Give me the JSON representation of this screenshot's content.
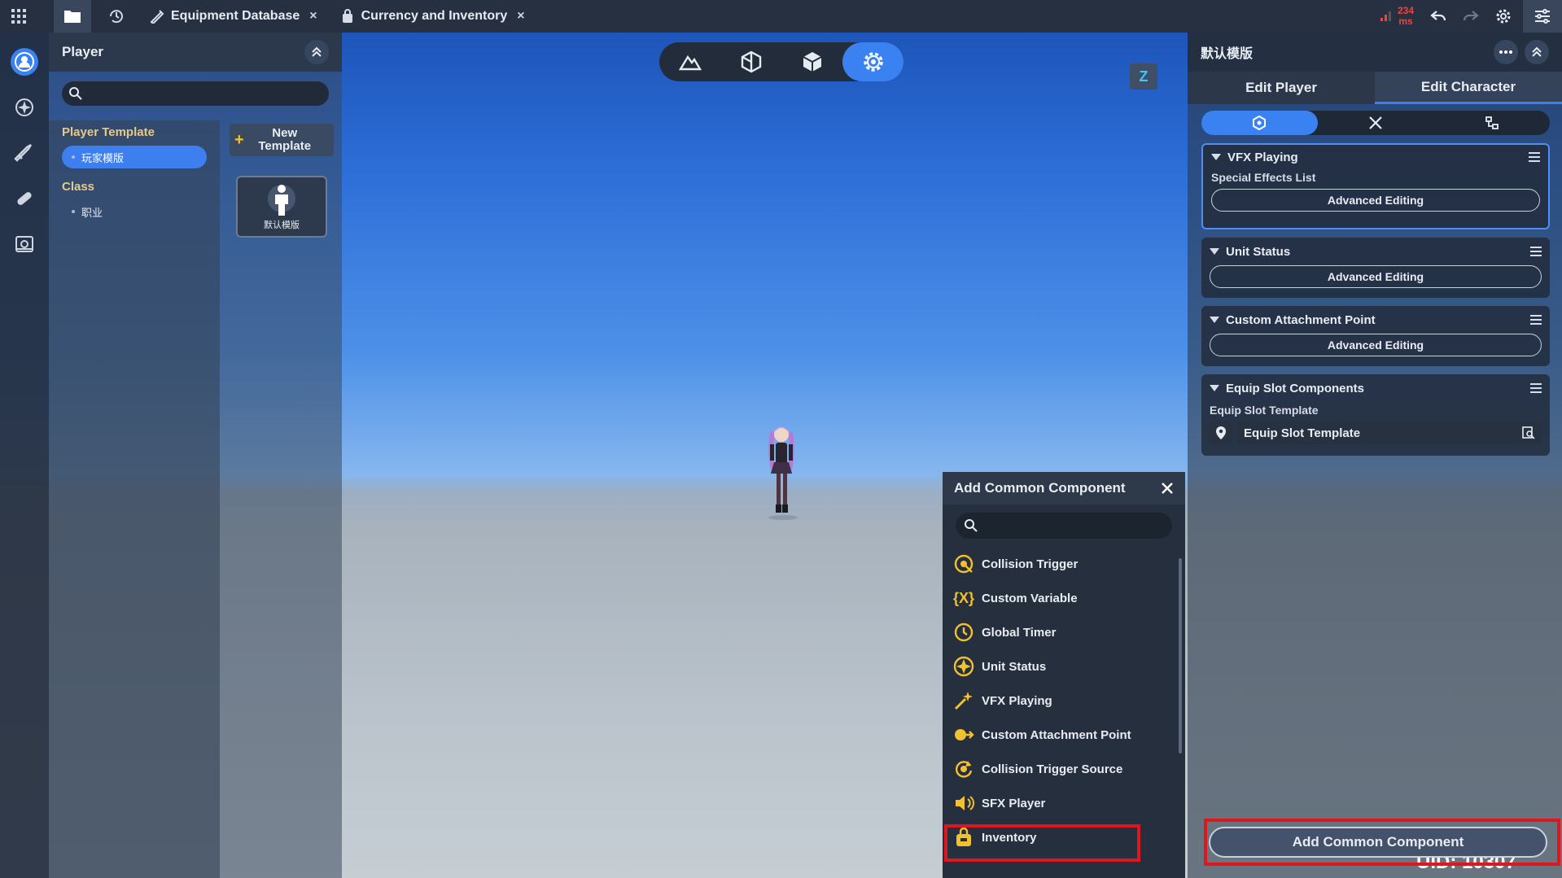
{
  "topbar": {
    "tabs": [
      {
        "label": "Equipment Database",
        "close": "×"
      },
      {
        "label": "Currency and Inventory",
        "close": "×"
      }
    ],
    "ping_value": "234",
    "ping_unit": "ms"
  },
  "left_panel": {
    "title": "Player",
    "search_placeholder": "",
    "section_player_template": "Player Template",
    "player_template_item": "玩家模版",
    "section_class": "Class",
    "class_item": "职业",
    "new_template_label": "New Template",
    "template_card_label": "默认模版"
  },
  "viewport": {
    "z_badge": "Z"
  },
  "right_panel": {
    "title": "默认模版",
    "tab_edit_player": "Edit Player",
    "tab_edit_character": "Edit Character",
    "cards": [
      {
        "title": "VFX Playing",
        "sub_label": "Special Effects List",
        "button": "Advanced Editing"
      },
      {
        "title": "Unit Status",
        "button": "Advanced Editing"
      },
      {
        "title": "Custom Attachment Point",
        "button": "Advanced Editing"
      },
      {
        "title": "Equip Slot Components",
        "sub_label": "Equip Slot Template",
        "field_value": "Equip Slot Template"
      }
    ],
    "add_button": "Add Common Component",
    "uid": "UID: 10307"
  },
  "popup": {
    "title": "Add Common Component",
    "search_placeholder": "",
    "items": [
      {
        "label": "Collision Trigger",
        "icon": "collision-trigger-icon"
      },
      {
        "label": "Custom Variable",
        "icon": "custom-variable-icon"
      },
      {
        "label": "Global Timer",
        "icon": "global-timer-icon"
      },
      {
        "label": "Unit Status",
        "icon": "unit-status-icon"
      },
      {
        "label": "VFX Playing",
        "icon": "vfx-playing-icon"
      },
      {
        "label": "Custom Attachment Point",
        "icon": "custom-attachment-point-icon"
      },
      {
        "label": "Collision Trigger Source",
        "icon": "collision-trigger-source-icon"
      },
      {
        "label": "SFX Player",
        "icon": "sfx-player-icon"
      },
      {
        "label": "Inventory",
        "icon": "inventory-icon"
      }
    ]
  },
  "colors": {
    "accent": "#3a82f2",
    "highlight": "#e0161f",
    "icon_gold": "#f2c12e"
  }
}
